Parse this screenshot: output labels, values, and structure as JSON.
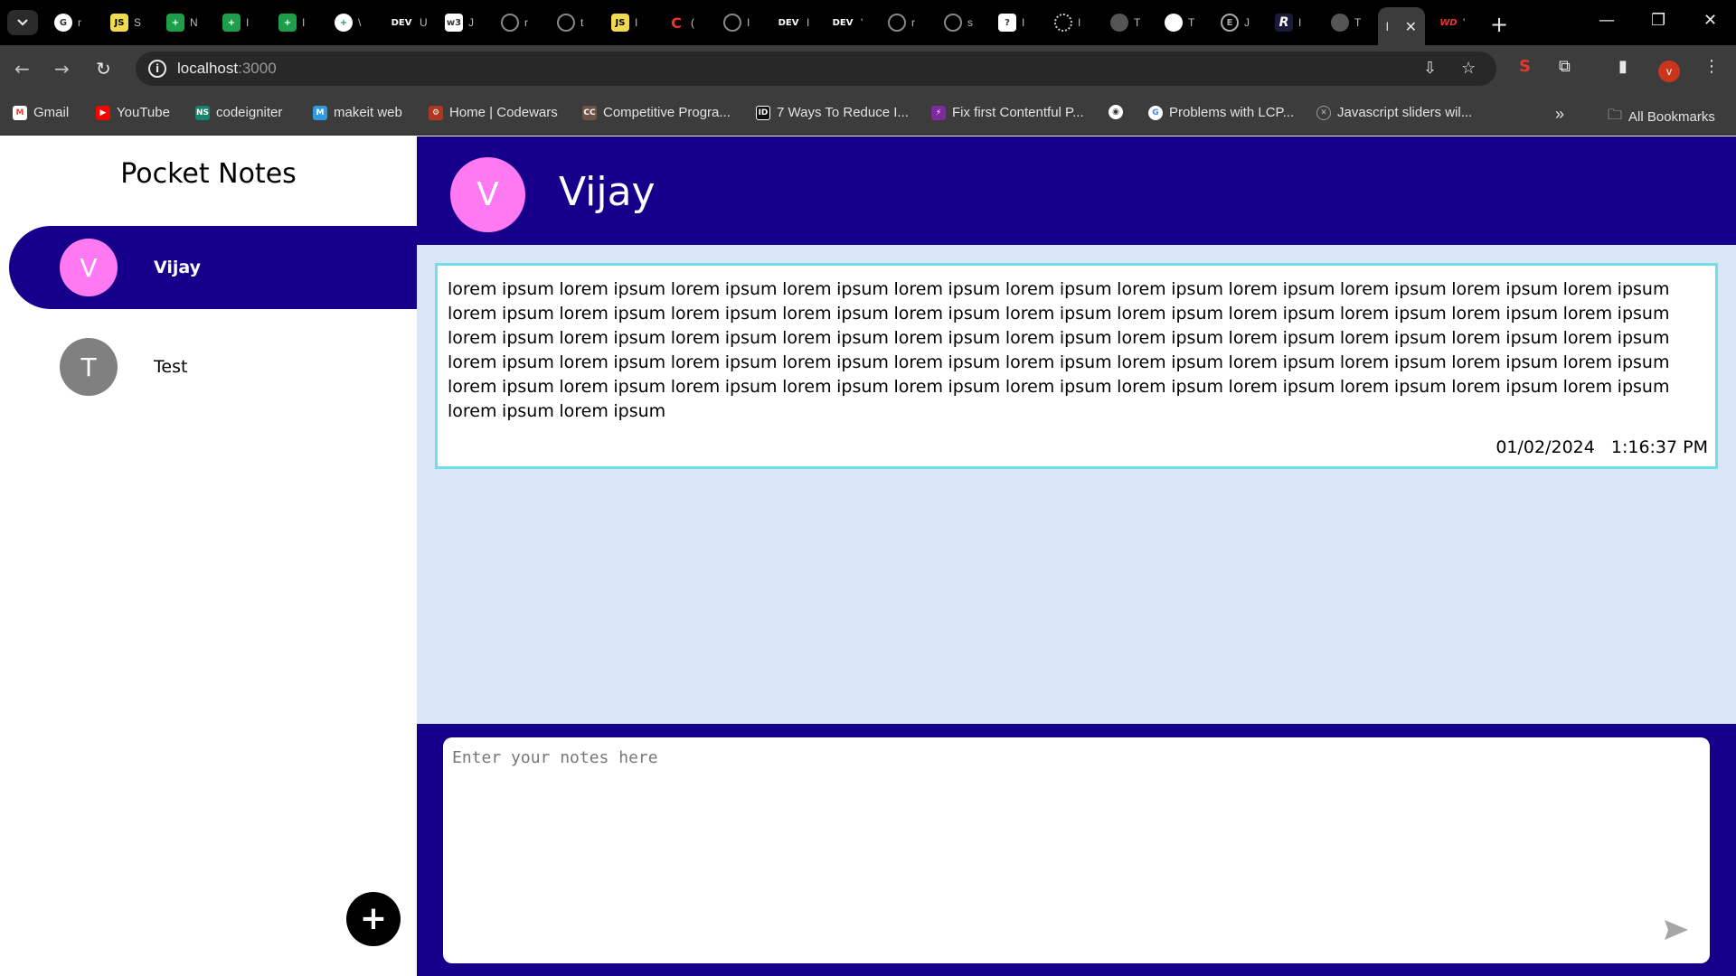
{
  "browser": {
    "active_tab_label": "l",
    "url_host": "localhost",
    "url_port": ":3000",
    "bookmarks": [
      {
        "label": "Gmail",
        "icon": "gmail-icon",
        "color": "#ea4335"
      },
      {
        "label": "YouTube",
        "icon": "youtube-icon",
        "color": "#ff0000"
      },
      {
        "label": "codeigniter",
        "icon": "ns-icon",
        "color": "#16836a"
      },
      {
        "label": "makeit web",
        "icon": "m-icon",
        "color": "#2f9ae0"
      },
      {
        "label": "Home | Codewars",
        "icon": "codewars-icon",
        "color": "#b1361e"
      },
      {
        "label": "Competitive Progra...",
        "icon": "cc-icon",
        "color": "#6e5346"
      },
      {
        "label": "7 Ways To Reduce I...",
        "icon": "id-icon",
        "color": "#111111"
      },
      {
        "label": "Fix first Contentful P...",
        "icon": "lighthouse-icon",
        "color": "#7b2b9c"
      },
      {
        "label": "",
        "icon": "globe-icon",
        "color": "#ffffff"
      },
      {
        "label": "Problems with LCP...",
        "icon": "google-icon",
        "color": "#4285f4"
      },
      {
        "label": "Javascript sliders wil...",
        "icon": "x-circle-icon",
        "color": "#888888"
      }
    ],
    "all_bookmarks_label": "All Bookmarks"
  },
  "sidebar": {
    "title": "Pocket Notes",
    "groups": [
      {
        "initial": "V",
        "name": "Vijay",
        "color": "#ff79f2",
        "active": true
      },
      {
        "initial": "T",
        "name": "Test",
        "color": "#808080",
        "active": false
      }
    ],
    "add_button_label": "+"
  },
  "chat": {
    "header_initial": "V",
    "header_name": "Vijay",
    "header_color": "#ff79f2",
    "accent": "#16008b",
    "notes": [
      {
        "text": "lorem ipsum lorem ipsum lorem ipsum lorem ipsum lorem ipsum lorem ipsum lorem ipsum lorem ipsum lorem ipsum lorem ipsum lorem ipsum lorem ipsum lorem ipsum lorem ipsum lorem ipsum lorem ipsum lorem ipsum lorem ipsum lorem ipsum lorem ipsum lorem ipsum lorem ipsum lorem ipsum lorem ipsum lorem ipsum lorem ipsum lorem ipsum lorem ipsum lorem ipsum lorem ipsum lorem ipsum lorem ipsum lorem ipsum lorem ipsum lorem ipsum lorem ipsum lorem ipsum lorem ipsum lorem ipsum lorem ipsum lorem ipsum lorem ipsum lorem ipsum lorem ipsum lorem ipsum lorem ipsum lorem ipsum lorem ipsum lorem ipsum lorem ipsum lorem ipsum lorem ipsum lorem ipsum lorem ipsum lorem ipsum lorem ipsum lorem ipsum",
        "date": "01/02/2024",
        "time": "1:16:37 PM"
      }
    ],
    "composer_placeholder": "Enter your notes here"
  }
}
